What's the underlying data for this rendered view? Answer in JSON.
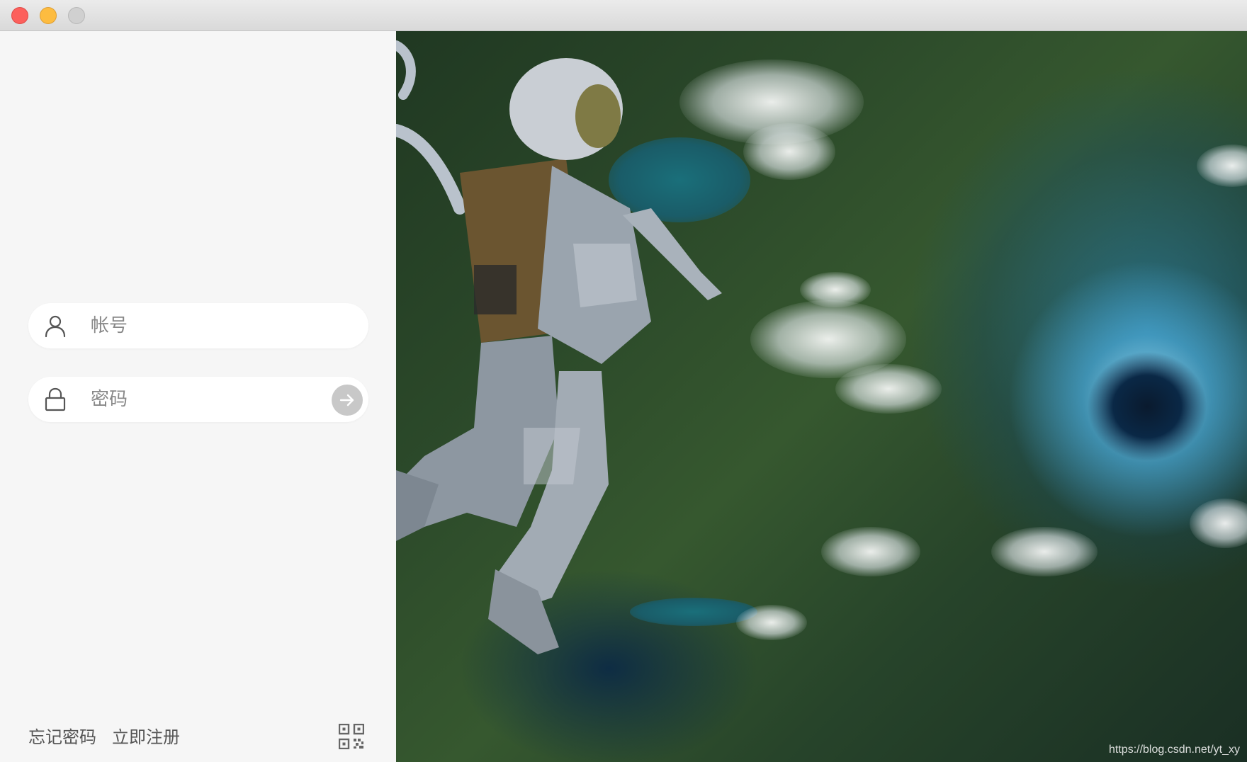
{
  "window": {
    "controls": [
      "close",
      "minimize",
      "zoom"
    ],
    "colors": {
      "close": "#fc605c",
      "minimize": "#fdbc40",
      "zoom": "#d0d0d0"
    }
  },
  "login": {
    "account": {
      "placeholder": "帐号",
      "value": "",
      "icon": "user-icon"
    },
    "password": {
      "placeholder": "密码",
      "value": "",
      "icon": "lock-icon"
    },
    "submit_icon": "arrow-right-icon",
    "forgot_password": "忘记密码",
    "register": "立即注册",
    "qrcode_icon": "qrcode-icon"
  },
  "hero": {
    "description_icon": "astronaut-wormhole-illustration",
    "watermark": "https://blog.csdn.net/yt_xy"
  }
}
